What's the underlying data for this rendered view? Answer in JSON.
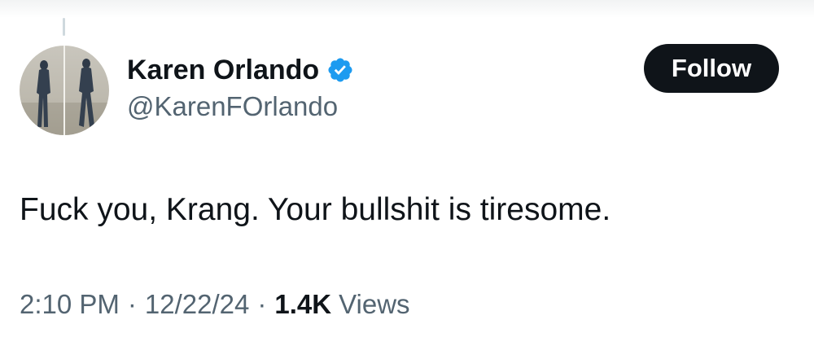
{
  "author": {
    "display_name": "Karen Orlando",
    "handle": "@KarenFOrlando",
    "verified": true
  },
  "follow_button": {
    "label": "Follow"
  },
  "tweet": {
    "text": "Fuck you, Krang. Your bullshit is tiresome."
  },
  "meta": {
    "time": "2:10 PM",
    "separator": "·",
    "date": "12/22/24",
    "views_count": "1.4K",
    "views_label": "Views"
  },
  "colors": {
    "text_primary": "#0f1419",
    "text_secondary": "#536471",
    "verified_blue": "#1d9bf0",
    "follow_bg": "#0f1419"
  },
  "icons": {
    "verified": "verified-badge-icon",
    "avatar": "avatar-silhouette-photo"
  }
}
